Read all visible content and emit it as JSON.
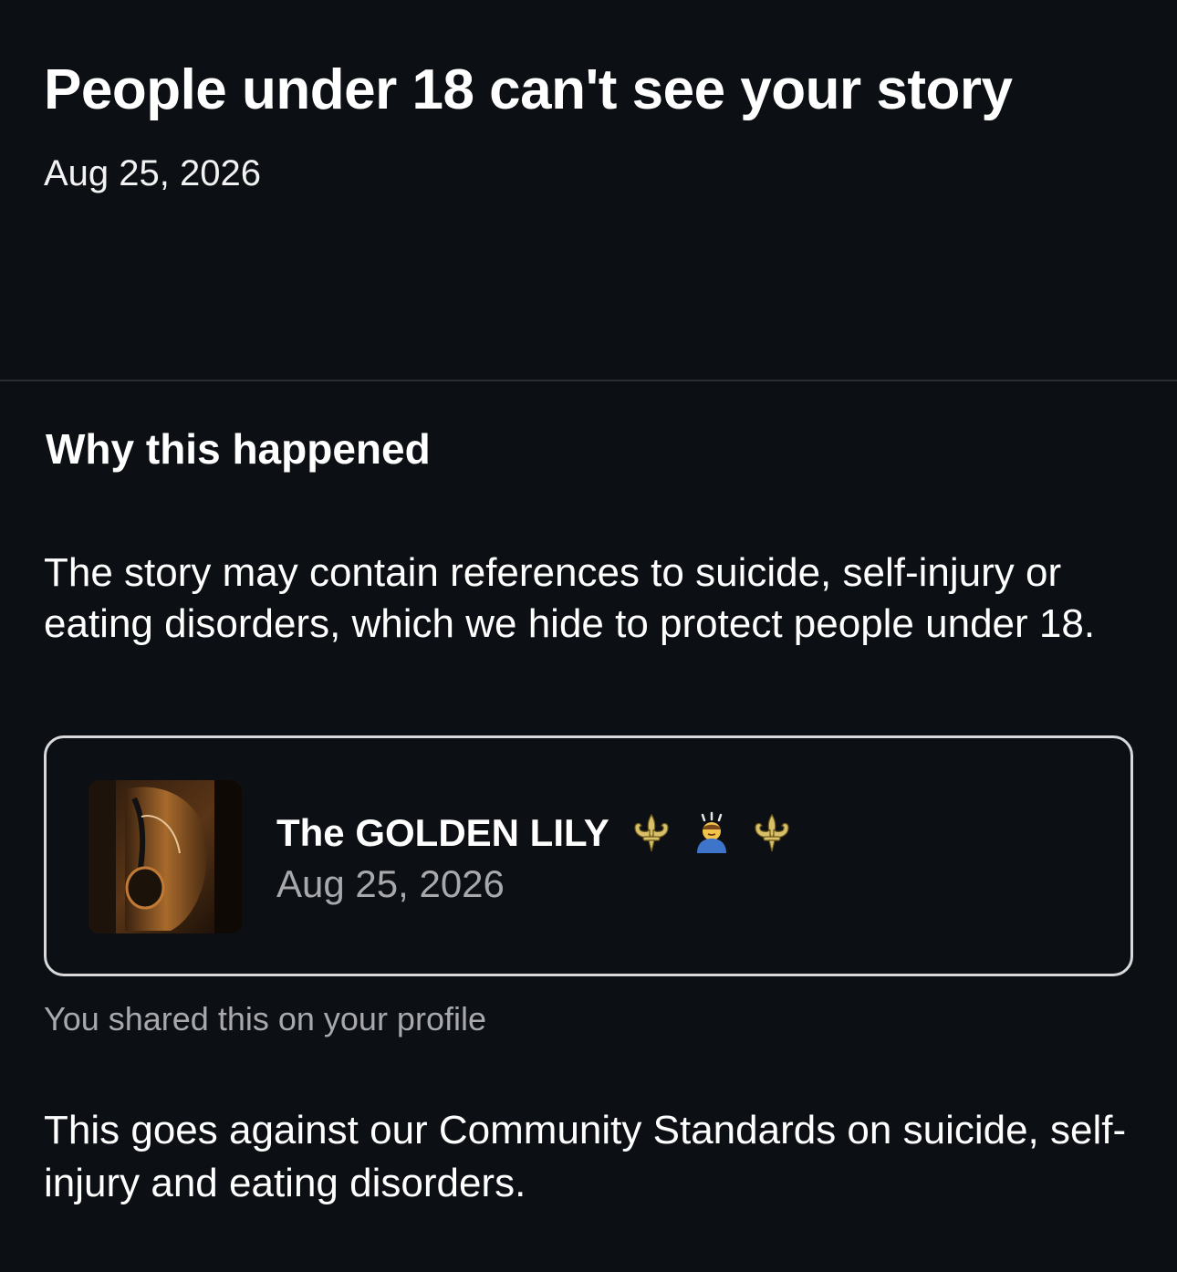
{
  "header": {
    "title": "People under 18 can't see your story",
    "date": "Aug 25, 2026"
  },
  "section": {
    "heading": "Why this happened",
    "reason": "The story may contain references to suicide, self-injury or eating disorders, which we hide to protect people under 18."
  },
  "story_card": {
    "title": "The GOLDEN LILY",
    "emojis": [
      "fleur-de-lis-icon",
      "bowing-person-icon",
      "fleur-de-lis-icon"
    ],
    "date": "Aug 25, 2026"
  },
  "shared_note": "You shared this on your profile",
  "standards_note": "This goes against our Community Standards on suicide, self-injury and eating disorders.",
  "colors": {
    "background": "#0c0f13",
    "text": "#ffffff",
    "muted": "#a8a9ad",
    "card_border": "#d9d9db",
    "divider": "#2a2d31"
  }
}
